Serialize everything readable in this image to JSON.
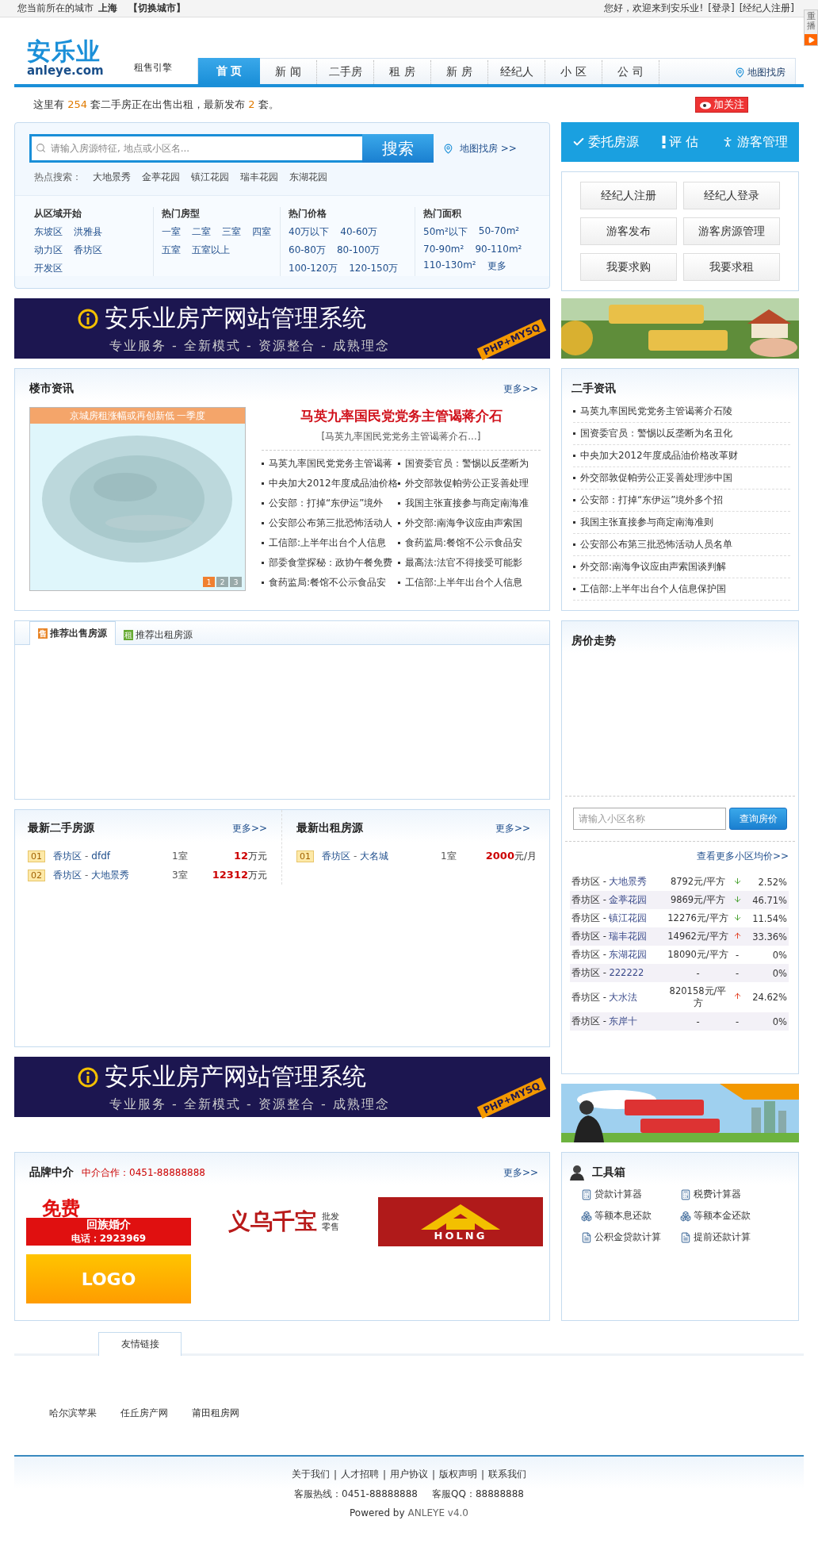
{
  "top_bar": {
    "city_prefix": "您当前所在的城市",
    "city": "上海",
    "switch": "【切换城市】",
    "greeting": "您好，欢迎来到安乐业!",
    "links": [
      "[登录]",
      "[经纪人注册]"
    ]
  },
  "side_widget": {
    "label": "重播"
  },
  "header": {
    "logo": "安乐业",
    "domain": "anleye.com",
    "tagline": "租售引擎",
    "nav": [
      {
        "label": "首 页",
        "selected": true
      },
      {
        "label": "新 闻",
        "selected": false
      },
      {
        "label": "二手房",
        "selected": false
      },
      {
        "label": "租 房",
        "selected": false
      },
      {
        "label": "新 房",
        "selected": false
      },
      {
        "label": "经纪人",
        "selected": false
      },
      {
        "label": "小 区",
        "selected": false
      },
      {
        "label": "公 司",
        "selected": false
      }
    ],
    "map_link": "地图找房"
  },
  "stats": {
    "prefix": "这里有",
    "count": "254",
    "middle": "套二手房正在出售出租，最新发布",
    "latest": "2",
    "suffix": "套。",
    "follow": "加关注"
  },
  "search": {
    "placeholder": "请输入房源特征, 地点或小区名...",
    "button": "搜索",
    "map_link": "地图找房 >>",
    "hot_label": "热点搜索：",
    "hot": [
      "大地景秀",
      "金葶花园",
      "镇江花园",
      "瑞丰花园",
      "东湖花园"
    ],
    "filters": [
      {
        "title": "从区域开始",
        "links": [
          "东坡区",
          "洪雅县",
          "动力区",
          "香坊区",
          "开发区"
        ]
      },
      {
        "title": "热门房型",
        "links": [
          "一室",
          "二室",
          "三室",
          "四室",
          "五室",
          "五室以上"
        ]
      },
      {
        "title": "热门价格",
        "links": [
          "40万以下",
          "40-60万",
          "60-80万",
          "80-100万",
          "100-120万",
          "120-150万"
        ]
      },
      {
        "title": "热门面积",
        "links": [
          "50m²以下",
          "50-70m²",
          "70-90m²",
          "90-110m²",
          "110-130m²",
          "更多"
        ]
      }
    ]
  },
  "actions": [
    "委托房源",
    "评 估",
    "游客管理"
  ],
  "account_buttons": [
    "经纪人注册",
    "经纪人登录",
    "游客发布",
    "游客房源管理",
    "我要求购",
    "我要求租"
  ],
  "banners": [
    {
      "title": "安乐业房产网站管理系统",
      "slogan": "专业服务 - 全新模式 - 资源整合 - 成熟理念",
      "tag": "PHP+MYSQ"
    },
    {
      "title": "安乐业房产网站管理系统",
      "slogan": "专业服务 - 全新模式 - 资源整合 - 成熟理念",
      "tag": "PHP+MYSQ"
    }
  ],
  "news": {
    "title": "楼市资讯",
    "more": "更多>>",
    "caption": "京城房租涨幅或再创新低 一季度",
    "pages": [
      {
        "label": "1",
        "selected": true
      },
      {
        "label": "2",
        "selected": false
      },
      {
        "label": "3",
        "selected": false
      }
    ],
    "headline": "马英九率国民党党务主管谒蒋介石",
    "summary": "[马英九率国民党党务主管谒蒋介石...]",
    "items": [
      "马英九率国民党党务主管谒蒋",
      "国资委官员：警惕以反垄断为",
      "中央加大2012年度成品油价格",
      "外交部敦促帕劳公正妥善处理",
      "公安部：打掉“东伊运”境外",
      "我国主张直接参与商定南海准",
      "公安部公布第三批恐怖活动人",
      "外交部:南海争议应由声索国",
      "工信部:上半年出台个人信息",
      "食药监局:餐馆不公示食品安",
      "部委食堂探秘：政协午餐免费",
      "最高法:法官不得接受可能影",
      "食药监局:餐馆不公示食品安",
      "工信部:上半年出台个人信息"
    ]
  },
  "second_hand_news": {
    "title": "二手资讯",
    "items": [
      "马英九率国民党党务主管谒蒋介石陵",
      "国资委官员：警惕以反垄断为名丑化",
      "中央加大2012年度成品油价格改革财",
      "外交部敦促帕劳公正妥善处理涉中国",
      "公安部：打掉“东伊运”境外多个招",
      "我国主张直接参与商定南海准则",
      "公安部公布第三批恐怖活动人员名单",
      "外交部:南海争议应由声索国谈判解",
      "工信部:上半年出台个人信息保护国"
    ]
  },
  "recommend": {
    "tabs": [
      {
        "badge": "售",
        "label": "推荐出售房源",
        "selected": true
      },
      {
        "badge": "租",
        "label": "推荐出租房源",
        "selected": false
      }
    ]
  },
  "latest_sale": {
    "title": "最新二手房源",
    "more": "更多>>",
    "separator": "-",
    "rows": [
      {
        "num": "01",
        "district": "香坊区",
        "name": "dfdf",
        "rooms": "1室",
        "price": "12",
        "unit": "万元"
      },
      {
        "num": "02",
        "district": "香坊区",
        "name": "大地景秀",
        "rooms": "3室",
        "price": "12312",
        "unit": "万元"
      }
    ]
  },
  "latest_rent": {
    "title": "最新出租房源",
    "more": "更多>>",
    "separator": "-",
    "rows": [
      {
        "num": "01",
        "district": "香坊区",
        "name": "大名城",
        "rooms": "1室",
        "price": "2000",
        "unit": "元/月"
      }
    ]
  },
  "price_trend": {
    "title": "房价走势",
    "placeholder": "请输入小区名称",
    "button": "查询房价",
    "more": "查看更多小区均价>>",
    "separator": "-",
    "rows": [
      {
        "district": "香坊区",
        "name": "大地景秀",
        "price": "8792元/平方",
        "kind": "down",
        "change": "2.52%"
      },
      {
        "district": "香坊区",
        "name": "金葶花园",
        "price": "9869元/平方",
        "kind": "down",
        "change": "46.71%"
      },
      {
        "district": "香坊区",
        "name": "镇江花园",
        "price": "12276元/平方",
        "kind": "down",
        "change": "11.54%"
      },
      {
        "district": "香坊区",
        "name": "瑞丰花园",
        "price": "14962元/平方",
        "kind": "up",
        "change": "33.36%"
      },
      {
        "district": "香坊区",
        "name": "东湖花园",
        "price": "18090元/平方",
        "kind": "none",
        "trend_text": "-",
        "change": "0%"
      },
      {
        "district": "香坊区",
        "name": "222222",
        "price": "-",
        "kind": "none",
        "trend_text": "-",
        "change": "0%"
      },
      {
        "district": "香坊区",
        "name": "大水法",
        "price": "820158元/平方",
        "kind": "up",
        "change": "24.62%"
      },
      {
        "district": "香坊区",
        "name": "东岸十",
        "price": "-",
        "kind": "none",
        "trend_text": "-",
        "change": "0%"
      }
    ]
  },
  "brand": {
    "title": "品牌中介",
    "contact": "中介合作：0451-88888888",
    "more": "更多>>",
    "logos": [
      {
        "kind": "marriage",
        "lines": [
          "免费",
          "回族婚介",
          "电话：2923969"
        ]
      },
      {
        "kind": "shop",
        "lines": [
          "义乌千宝",
          "批发零售"
        ]
      },
      {
        "kind": "house",
        "lines": [
          "HOLNG"
        ]
      },
      {
        "kind": "plain",
        "lines": [
          "LOGO"
        ]
      }
    ]
  },
  "toolbox": {
    "title": "工具箱",
    "items": [
      "贷款计算器",
      "税费计算器",
      "等额本息还款",
      "等额本金还款",
      "公积金贷款计算",
      "提前还款计算"
    ]
  },
  "friend_links": {
    "tab": "友情链接",
    "items": [
      "哈尔滨苹果",
      "任丘房产网",
      "莆田租房网"
    ]
  },
  "footer": {
    "links": [
      "关于我们",
      "人才招聘",
      "用户协议",
      "版权声明",
      "联系我们"
    ],
    "separator": "|",
    "hotline": "客服热线：0451-88888888",
    "qq": "客服QQ：88888888",
    "powered": "Powered by",
    "version": "ANLEYE v4.0"
  }
}
